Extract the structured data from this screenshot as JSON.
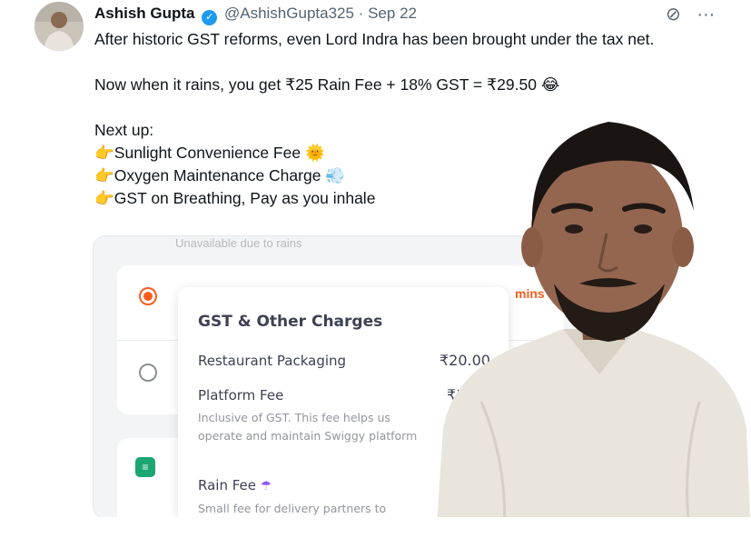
{
  "tweet": {
    "author_name": "Ashish Gupta",
    "verified_mark": "✓",
    "handle": "@AshishGupta325",
    "separator": "·",
    "date": "Sep 22",
    "line1": "After historic GST reforms, even Lord Indra has been brought under the tax net.",
    "line2": "Now when it rains, you get ₹25 Rain Fee + 18% GST = ₹29.50",
    "line2_emoji": "😂",
    "line3": "Next up:",
    "items": [
      {
        "text": "Sunlight Convenience Fee",
        "emoji": "🌞"
      },
      {
        "text": "Oxygen Maintenance Charge",
        "emoji": "💨"
      },
      {
        "text": "GST on Breathing, Pay as you inhale",
        "emoji": ""
      }
    ],
    "pointer_emoji": "👉",
    "grok_icon": "⊘",
    "more_icon": "···"
  },
  "media": {
    "top_text": "Unavailable due to rains",
    "mins_text": "mins",
    "popup": {
      "title": "GST & Other Charges",
      "rows": [
        {
          "label": "Restaurant Packaging",
          "price": "₹20.00"
        },
        {
          "label": "Platform Fee",
          "price": "₹1"
        },
        {
          "label": "Rain Fee",
          "price": ""
        }
      ],
      "platform_desc": "Inclusive of GST. This fee helps us operate and maintain Swiggy platform",
      "rain_desc": "Small fee for delivery partners to"
    }
  },
  "colors": {
    "swiggy_orange": "#fc5b1e",
    "verified_blue": "#1d9bf0",
    "text_primary": "#0f1419",
    "text_secondary": "#536471"
  }
}
